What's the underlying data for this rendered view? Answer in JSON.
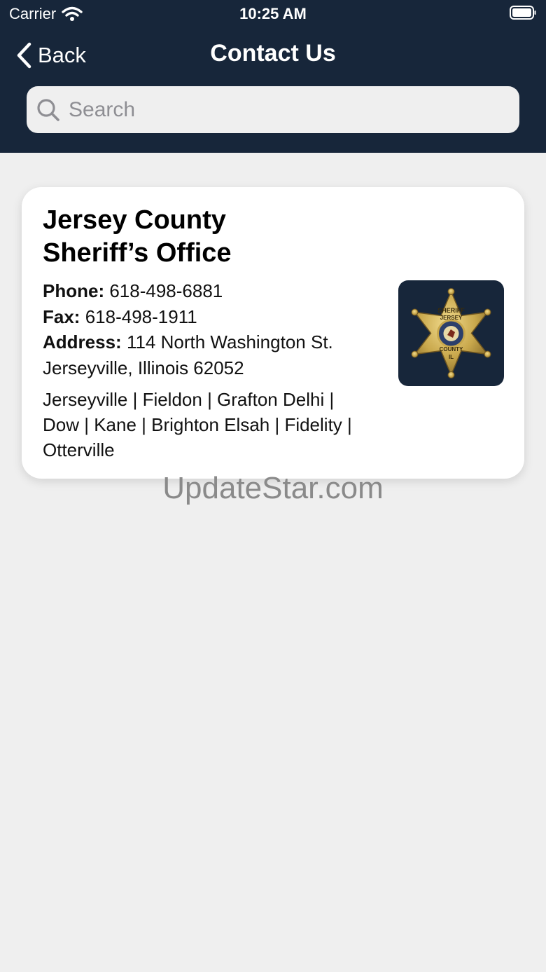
{
  "status": {
    "carrier": "Carrier",
    "time": "10:25 AM"
  },
  "nav": {
    "back_label": "Back",
    "title": "Contact Us"
  },
  "search": {
    "placeholder": "Search",
    "value": ""
  },
  "contact": {
    "title_line1": "Jersey County",
    "title_line2": "Sheriff’s Office",
    "phone_label": "Phone:",
    "phone": "618-498-6881",
    "fax_label": "Fax:",
    "fax": "618-498-1911",
    "address_label": "Address:",
    "address_line1": "114 North Washington St.",
    "address_line2": "Jerseyville, Illinois 62052",
    "towns_line1": "Jerseyville | Fieldon | Grafton Delhi |",
    "towns_line2": "Dow | Kane | Brighton Elsah | Fidelity |",
    "towns_line3": "Otterville",
    "badge": {
      "icon": "sheriff-star-badge",
      "text_top": "SHERIFF",
      "text_mid": "JERSEY",
      "text_bottom": "COUNTY",
      "text_state": "IL"
    }
  },
  "watermark": "UpdateStar.com",
  "colors": {
    "header": "#17263a",
    "background": "#efefef",
    "card": "#ffffff",
    "badge_gold": "#c9a84c"
  },
  "icons": {
    "wifi": "wifi-icon",
    "battery": "battery-icon",
    "back": "chevron-left-icon",
    "search": "magnifier-icon"
  }
}
